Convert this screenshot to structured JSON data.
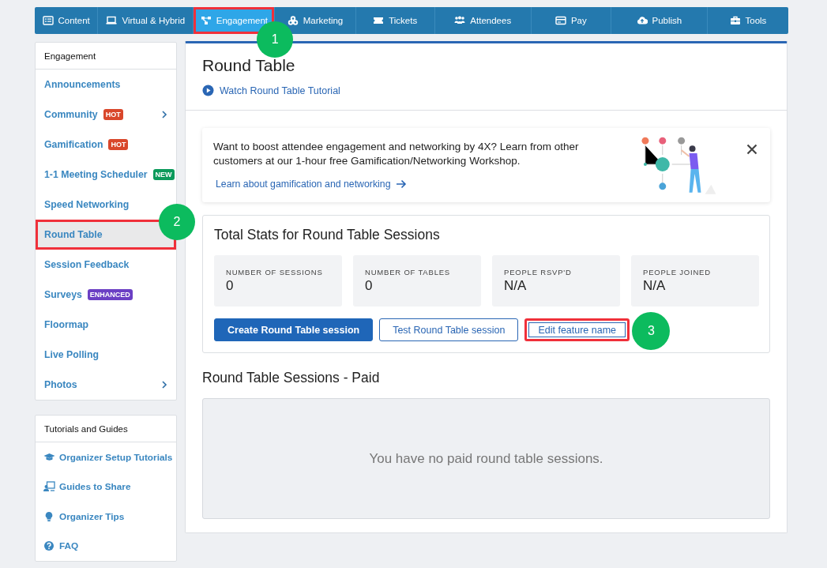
{
  "nav": [
    {
      "label": "Content",
      "selected": false,
      "highlighted": false
    },
    {
      "label": "Virtual & Hybrid",
      "selected": false,
      "highlighted": false
    },
    {
      "label": "Engagement",
      "selected": true,
      "highlighted": true,
      "callout": "1"
    },
    {
      "label": "Marketing",
      "selected": false,
      "highlighted": false
    },
    {
      "label": "Tickets",
      "selected": false,
      "highlighted": false
    },
    {
      "label": "Attendees",
      "selected": false,
      "highlighted": false
    },
    {
      "label": "Pay",
      "selected": false,
      "highlighted": false
    },
    {
      "label": "Publish",
      "selected": false,
      "highlighted": false
    },
    {
      "label": "Tools",
      "selected": false,
      "highlighted": false
    }
  ],
  "sidebar": {
    "title": "Engagement",
    "items": [
      {
        "label": "Announcements",
        "selected": false,
        "highlighted": false,
        "has_submenu": false
      },
      {
        "label": "Community",
        "badge": {
          "text": "HOT",
          "color": "#d9472b"
        },
        "selected": false,
        "highlighted": false,
        "has_submenu": true
      },
      {
        "label": "Gamification",
        "badge": {
          "text": "HOT",
          "color": "#d9472b"
        },
        "selected": false,
        "highlighted": false,
        "has_submenu": false
      },
      {
        "label": "1-1 Meeting Scheduler",
        "badge": {
          "text": "NEW",
          "color": "#0b9a5b"
        },
        "selected": false,
        "highlighted": false,
        "has_submenu": false
      },
      {
        "label": "Speed Networking",
        "selected": false,
        "highlighted": false,
        "has_submenu": false
      },
      {
        "label": "Round Table",
        "selected": true,
        "highlighted": true,
        "has_submenu": false,
        "callout": "2"
      },
      {
        "label": "Session Feedback",
        "selected": false,
        "highlighted": false,
        "has_submenu": false
      },
      {
        "label": "Surveys",
        "badge": {
          "text": "ENHANCED",
          "color": "#6b3fc4"
        },
        "selected": false,
        "highlighted": false,
        "has_submenu": false
      },
      {
        "label": "Floormap",
        "selected": false,
        "highlighted": false,
        "has_submenu": false
      },
      {
        "label": "Live Polling",
        "selected": false,
        "highlighted": false,
        "has_submenu": false
      },
      {
        "label": "Photos",
        "selected": false,
        "highlighted": false,
        "has_submenu": true
      }
    ]
  },
  "guides": {
    "title": "Tutorials and Guides",
    "items": [
      {
        "label": "Organizer Setup Tutorials"
      },
      {
        "label": "Guides to Share"
      },
      {
        "label": "Organizer Tips"
      },
      {
        "label": "FAQ"
      }
    ]
  },
  "page": {
    "title": "Round Table",
    "tutorial_link": "Watch Round Table Tutorial",
    "promo": {
      "text": "Want to boost attendee engagement and networking by 4X? Learn from other customers at our 1-hour free Gamification/Networking Workshop.",
      "link": "Learn about gamification and networking"
    },
    "stats": {
      "title": "Total Stats for Round Table Sessions",
      "items": [
        {
          "label": "NUMBER OF SESSIONS",
          "value": "0"
        },
        {
          "label": "NUMBER OF TABLES",
          "value": "0"
        },
        {
          "label": "PEOPLE RSVP'D",
          "value": "N/A"
        },
        {
          "label": "PEOPLE JOINED",
          "value": "N/A"
        }
      ],
      "buttons": [
        {
          "label": "Create Round Table session",
          "kind": "primary",
          "highlighted": false
        },
        {
          "label": "Test Round Table session",
          "kind": "outline",
          "highlighted": false
        },
        {
          "label": "Edit feature name",
          "kind": "outline",
          "highlighted": true,
          "callout": "3"
        }
      ]
    },
    "sessions": {
      "title": "Round Table Sessions - Paid",
      "empty_message": "You have no paid round table sessions."
    }
  }
}
